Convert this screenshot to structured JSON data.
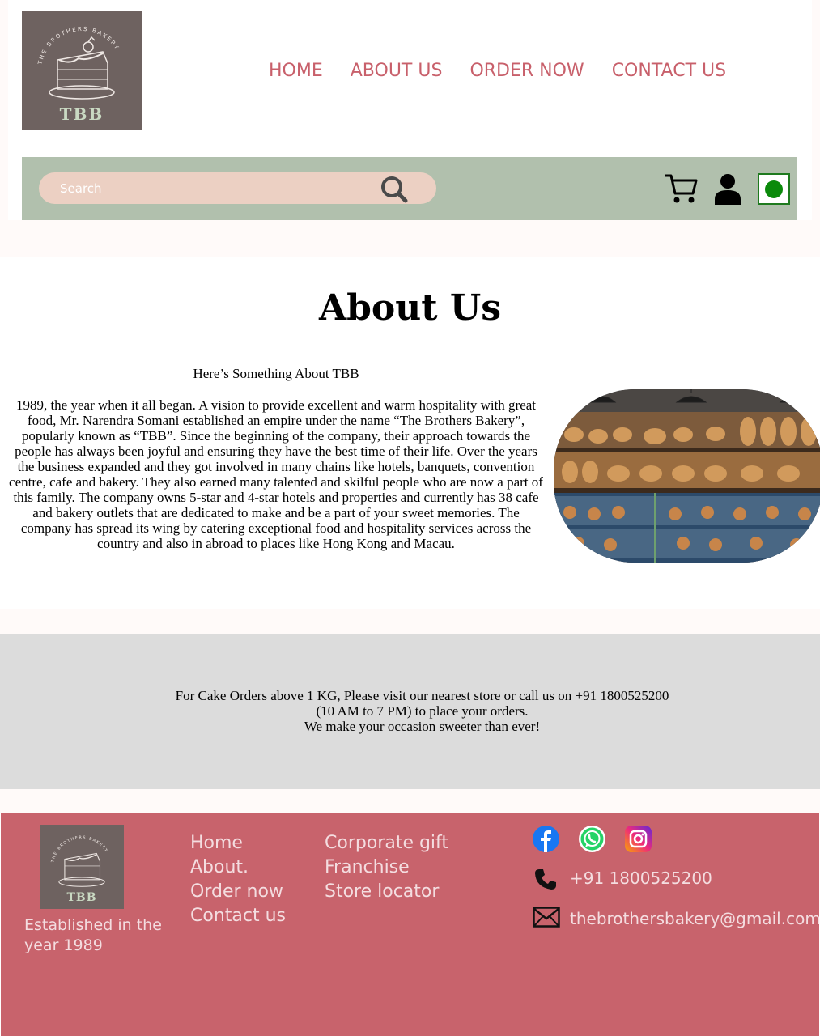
{
  "brand": {
    "logo_ring_text": "THE BROTHERS BAKERY",
    "logo_abbr": "TBB"
  },
  "nav": {
    "items": [
      "HOME",
      "ABOUT US",
      "ORDER NOW",
      "CONTACT US"
    ]
  },
  "search": {
    "placeholder": "Search"
  },
  "colors": {
    "nav_text": "#c8606b",
    "toolbar_bg": "#b1c0ad",
    "search_bg": "#ecd0c3",
    "footer_bg": "#c8636c",
    "grey_band": "#dcdcdc",
    "veg_green": "#0b8a0b"
  },
  "icons": {
    "search": "search-icon",
    "cart": "cart-icon",
    "user": "user-icon",
    "veg": "veg-indicator-icon",
    "facebook": "facebook-icon",
    "whatsapp": "whatsapp-icon",
    "instagram": "instagram-icon",
    "phone": "phone-icon",
    "mail": "mail-icon"
  },
  "about": {
    "title": "About Us",
    "subtitle": "Here’s Something About TBB",
    "body": "1989, the year when it all began. A vision to provide excellent and warm hospitality with great food, Mr. Narendra Somani established an empire under the name “The Brothers Bakery”, popularly known as “TBB”. Since the beginning of the company, their approach towards the people has always been joyful and ensuring they have the best time of their life. Over the years the business expanded and they got involved in many chains like hotels, banquets, convention centre, cafe and bakery. They also earned many talented and skilful people who are now a part of this family. The company owns 5-star and 4-star hotels and properties and currently has 38 cafe and bakery outlets that are dedicated to make and be a part of your sweet memories. The company has spread its wing by catering exceptional food and hospitality services across the country and also in abroad to places like Hong Kong and Macau."
  },
  "notice": {
    "line1": "For Cake Orders above 1 KG, Please visit our nearest store or call us on +91 1800525200",
    "line2": "(10 AM to 7 PM) to place your orders.",
    "line3": "We make your occasion sweeter than ever!"
  },
  "footer": {
    "logo_abbr": "TBB",
    "established": "Established in the year 1989",
    "col1": [
      "Home",
      "About.",
      "Order now",
      "Contact us"
    ],
    "col2": [
      "Corporate gift",
      "Franchise",
      "Store locator"
    ],
    "phone": "+91 1800525200",
    "email": "thebrothersbakery@gmail.com"
  }
}
